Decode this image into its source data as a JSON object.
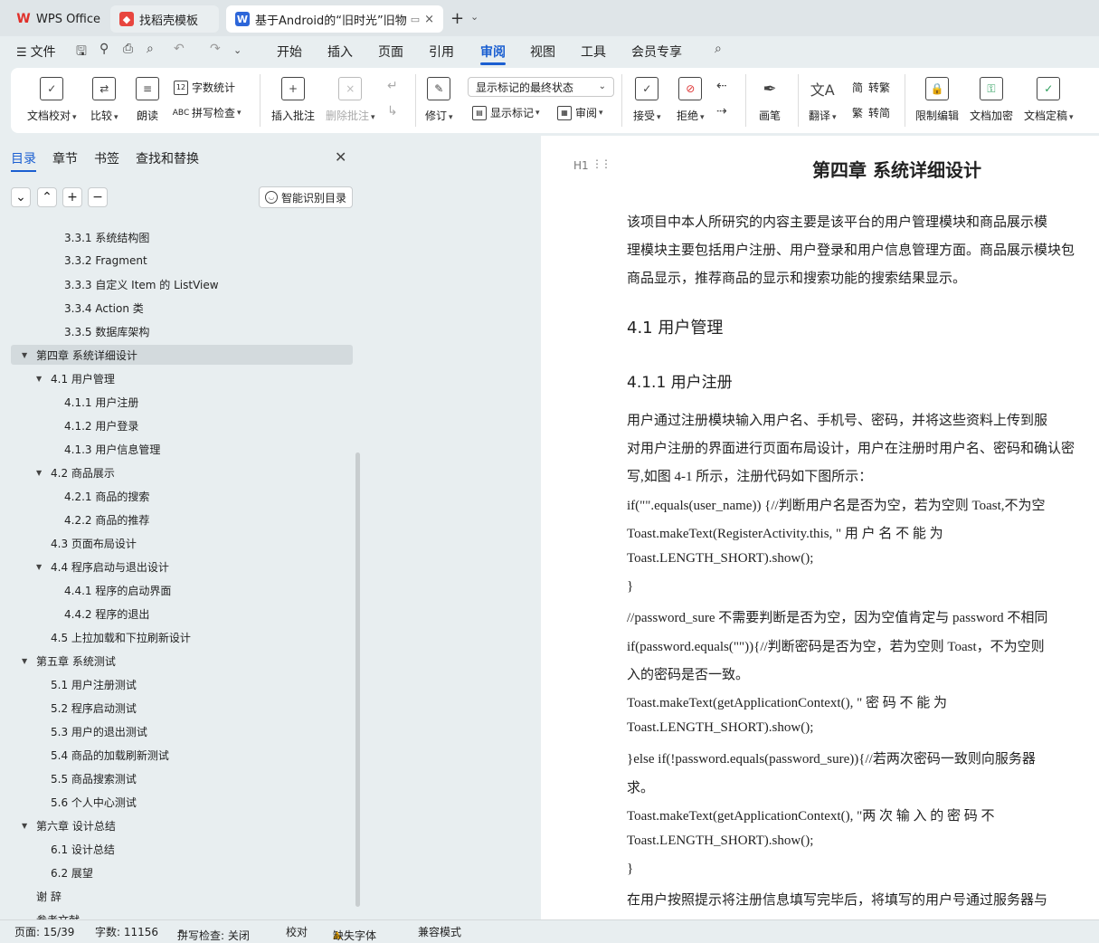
{
  "tabs": {
    "wps": "WPS Office",
    "template": "找稻壳模板",
    "document": "基于Android的“旧时光”旧物",
    "add": "+",
    "more": "⌄",
    "close": "×"
  },
  "menu": {
    "file": "文件",
    "items": [
      "开始",
      "插入",
      "页面",
      "引用",
      "审阅",
      "视图",
      "工具",
      "会员专享"
    ],
    "active": "审阅"
  },
  "ribbon": {
    "doc_proof": "文档校对",
    "compare": "比较",
    "read_aloud": "朗读",
    "word_count": "字数统计",
    "spell_check": "拼写检查",
    "insert_comment": "插入批注",
    "delete_comment": "删除批注",
    "revise": "修订",
    "markup_state": "显示标记的最终状态",
    "show_markup": "显示标记",
    "review_pane": "审阅",
    "accept": "接受",
    "reject": "拒绝",
    "pen": "画笔",
    "translate": "翻译",
    "to_traditional": "转繁",
    "to_simplified": "转简",
    "restrict_edit": "限制编辑",
    "doc_encrypt": "文档加密",
    "doc_finalize": "文档定稿"
  },
  "nav": {
    "tabs": [
      "目录",
      "章节",
      "书签",
      "查找和替换"
    ],
    "active_tab": "目录",
    "smart_toc": "智能识别目录",
    "toc": [
      {
        "label": "3.3.1 系统结构图",
        "level": 3
      },
      {
        "label": "3.3.2 Fragment",
        "level": 3
      },
      {
        "label": "3.3.3 自定义 Item 的 ListView",
        "level": 3
      },
      {
        "label": "3.3.4 Action 类",
        "level": 3
      },
      {
        "label": "3.3.5  数据库架构",
        "level": 3
      },
      {
        "label": "第四章  系统详细设计",
        "level": 1,
        "expanded": true,
        "selected": true
      },
      {
        "label": "4.1  用户管理",
        "level": 2,
        "expanded": true
      },
      {
        "label": "4.1.1 用户注册",
        "level": 3
      },
      {
        "label": "4.1.2 用户登录",
        "level": 3
      },
      {
        "label": "4.1.3  用户信息管理",
        "level": 3
      },
      {
        "label": "4.2  商品展示",
        "level": 2,
        "expanded": true
      },
      {
        "label": "4.2.1 商品的搜索",
        "level": 3
      },
      {
        "label": "4.2.2 商品的推荐",
        "level": 3
      },
      {
        "label": "4.3  页面布局设计",
        "level": 2
      },
      {
        "label": "4.4  程序启动与退出设计",
        "level": 2,
        "expanded": true
      },
      {
        "label": "4.4.1 程序的启动界面",
        "level": 3
      },
      {
        "label": "4.4.2 程序的退出",
        "level": 3
      },
      {
        "label": "4.5  上拉加载和下拉刷新设计",
        "level": 2
      },
      {
        "label": "第五章  系统测试",
        "level": 1,
        "expanded": true
      },
      {
        "label": "5.1  用户注册测试",
        "level": 2
      },
      {
        "label": "5.2 程序启动测试",
        "level": 2
      },
      {
        "label": "5.3 用户的退出测试",
        "level": 2
      },
      {
        "label": "5.4 商品的加载刷新测试",
        "level": 2
      },
      {
        "label": "5.5 商品搜索测试",
        "level": 2
      },
      {
        "label": "5.6 个人中心测试",
        "level": 2
      },
      {
        "label": "第六章  设计总结",
        "level": 1,
        "expanded": true
      },
      {
        "label": "6.1  设计总结",
        "level": 2
      },
      {
        "label": "6.2  展望",
        "level": 2
      },
      {
        "label": "谢    辞",
        "level": 1
      },
      {
        "label": "参考文献",
        "level": 1
      }
    ]
  },
  "document": {
    "heading_marker": "H1",
    "chapter_title": "第四章  系统详细设计",
    "intro": [
      "      该项目中本人所研究的内容主要是该平台的用户管理模块和商品展示模",
      "理模块主要包括用户注册、用户登录和用户信息管理方面。商品展示模块包",
      "商品显示，推荐商品的显示和搜索功能的搜索结果显示。"
    ],
    "section_4_1": "4.1  用户管理",
    "section_4_1_1": "4.1.1 用户注册",
    "body": [
      "      用户通过注册模块输入用户名、手机号、密码，并将这些资料上传到服",
      "对用户注册的界面进行页面布局设计，用户在注册时用户名、密码和确认密",
      "写,如图 4-1 所示，注册代码如下图所示：",
      "      if(\"\".equals(user_name)) {//判断用户名是否为空，若为空则 Toast,不为空",
      "      Toast.makeText(RegisterActivity.this,    \"  用    户    名    不    能    为",
      "Toast.LENGTH_SHORT).show();",
      "      }",
      "      //password_sure 不需要判断是否为空，因为空值肯定与 password 不相同",
      "       if(password.equals(\"\")){//判断密码是否为空，若为空则 Toast，不为空则",
      "入的密码是否一致。",
      "      Toast.makeText(getApplicationContext(),    \"   密    码    不    能    为",
      "Toast.LENGTH_SHORT).show();",
      "      }else if(!password.equals(password_sure)){//若两次密码一致则向服务器",
      "求。",
      "      Toast.makeText(getApplicationContext(),  \"两  次  输  入  的  密  码  不",
      "Toast.LENGTH_SHORT).show();",
      "      }",
      "      在用户按照提示将注册信息填写完毕后，将填写的用户号通过服务器与"
    ]
  },
  "status": {
    "page": "页面: 15/39",
    "words": "字数: 11156",
    "spell": "拼写检查: 关闭",
    "proof": "校对",
    "missing_font": "缺失字体",
    "compat": "兼容模式"
  },
  "colors": {
    "accent": "#1b5fd1",
    "background": "#e8eef0",
    "ribbon": "#ffffff",
    "selected_toc": "#d3dadd"
  }
}
